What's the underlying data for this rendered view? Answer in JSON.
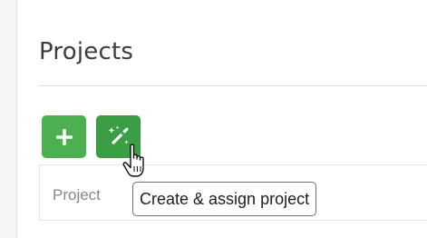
{
  "section": {
    "title": "Projects"
  },
  "toolbar": {
    "add_button_icon": "plus-icon",
    "magic_button_icon": "magic-wand-icon",
    "accent_color": "#4caf50"
  },
  "table": {
    "columns": [
      "Project"
    ]
  },
  "tooltip": {
    "text": "Create & assign project"
  },
  "cursor": {
    "icon": "hand-pointer-cursor-icon"
  }
}
